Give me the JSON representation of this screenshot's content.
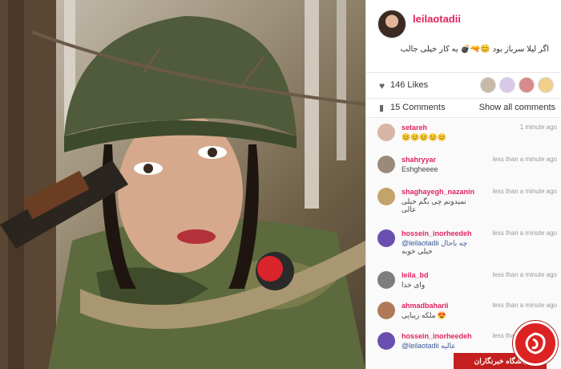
{
  "post": {
    "username": "leilaotadii",
    "caption": "اگر لیلا سرباز بود 😊🔫💣 یه کار خیلی جالب"
  },
  "stats": {
    "likes_label": "146 Likes",
    "comments_label": "15 Comments",
    "show_all_label": "Show all comments"
  },
  "comments": [
    {
      "user": "setareh",
      "time": "1 minute ago",
      "text": "😊😊😊😊😊",
      "text2": ""
    },
    {
      "user": "shahryyar",
      "time": "less than a minute ago",
      "text": "Eshgheeee",
      "text2": ""
    },
    {
      "user": "shaghayegh_nazanin",
      "time": "less than a minute ago",
      "text": "نمیدونم چی بگم خیلی",
      "text2": "عالی"
    },
    {
      "user": "hossein_inorheedeh",
      "time": "less than a minute ago",
      "text": "@leilaotadii چه باحال",
      "text2": "خیلی خوبه"
    },
    {
      "user": "leila_bd",
      "time": "less than a minute ago",
      "text": "وای خدا",
      "text2": ""
    },
    {
      "user": "ahmadbaharii",
      "time": "less than a minute ago",
      "text": "ملکه زیبایی 😍",
      "text2": ""
    },
    {
      "user": "hossein_inorheedeh",
      "time": "less than a minute ago",
      "text": "@leilaotadii عالیه",
      "text2": ""
    }
  ],
  "watermark": {
    "text": "باشگاه خبرنگاران"
  },
  "colors": {
    "username": "#e0245e",
    "watermark_red": "#c41e1e"
  },
  "icons": {
    "likes": "heart-icon",
    "comments": "comment-bubble-icon"
  }
}
